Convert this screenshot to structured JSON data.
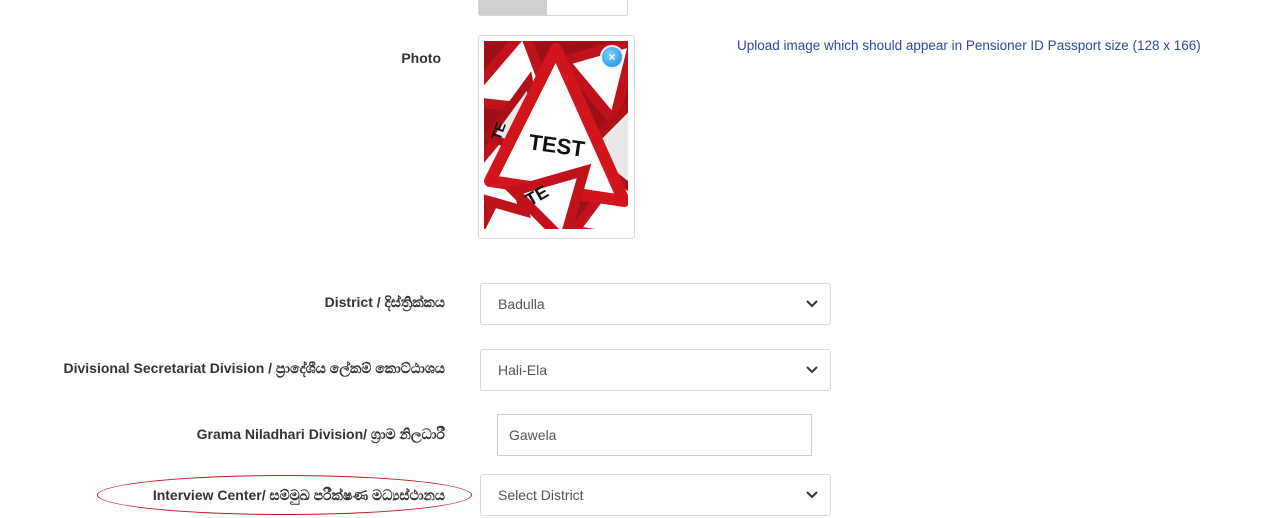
{
  "photo": {
    "label": "Photo",
    "help_text": "Upload image which should appear in Pensioner ID Passport size (128 x 166)",
    "remove_icon": "close-circle-icon",
    "sign_text": "TEST"
  },
  "district": {
    "label": "District / දිස්ත්‍රික්කය",
    "value": "Badulla"
  },
  "ds_division": {
    "label": "Divisional Secretariat Division / ප්‍රාදේශීය ලේකම් කොට්ඨාශය",
    "value": "Hali-Ela"
  },
  "gn_division": {
    "label": "Grama Niladhari Division/ ග්‍රාම නිලධාරී",
    "value": "Gawela"
  },
  "interview_center": {
    "label": "Interview Center/ සම්මුඛ පරීක්ෂණ මධ්‍යස්ථානය",
    "value": "Select District"
  },
  "colors": {
    "link": "#2e46a4",
    "highlight": "#c1181f",
    "sign_red": "#c0121a"
  }
}
